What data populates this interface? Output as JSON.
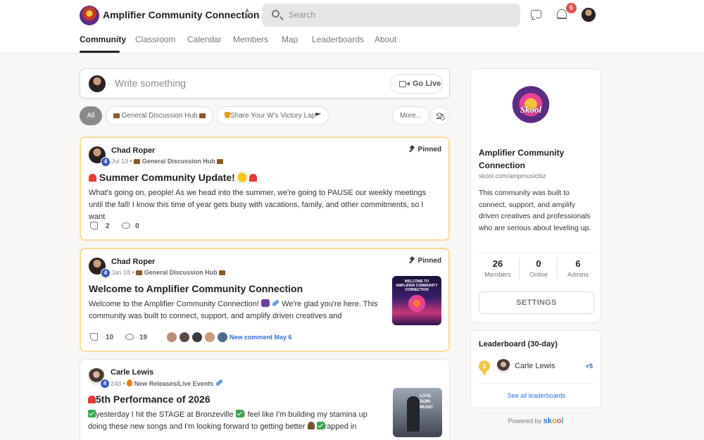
{
  "header": {
    "title": "Amplifier Community Connection",
    "search_placeholder": "Search",
    "notification_count": "6"
  },
  "tabs": [
    {
      "label": "Community"
    },
    {
      "label": "Classroom"
    },
    {
      "label": "Calendar"
    },
    {
      "label": "Members"
    },
    {
      "label": "Map"
    },
    {
      "label": "Leaderboards"
    },
    {
      "label": "About"
    }
  ],
  "composer": {
    "placeholder": "Write something",
    "go_live": "Go Live"
  },
  "filters": {
    "all": "All",
    "chip1": "General Discussion Hub",
    "chip2": "Share Your W's Victory Lap",
    "more": "More..."
  },
  "posts": [
    {
      "author": "Chad Roper",
      "level": "4",
      "date": "Jul 13",
      "category": "General Discussion Hub",
      "pinned": "Pinned",
      "title": "Summer Community Update!",
      "body": "What's going on, people! As we head into the summer, we're going to PAUSE our weekly meetings until the fall! I know this time of year gets busy with vacations, family, and other commitments, so I want",
      "likes": "2",
      "comments": "0"
    },
    {
      "author": "Chad Roper",
      "level": "4",
      "date": "Jan 18",
      "category": "General Discussion Hub",
      "pinned": "Pinned",
      "title": "Welcome to Amplifier Community Connection",
      "body_a": "Welcome to the Amplifier Community Connection!",
      "body_b": "We're glad you're here. This community was built to connect, support, and amplify driven creatives and",
      "likes": "10",
      "comments": "19",
      "new_comment": "New comment May 6",
      "thumb_text": "WELCOME TO AMPLIFIER COMMUNITY CONNECTION"
    },
    {
      "author": "Carle Lewis",
      "level": "4",
      "date": "24d",
      "category": "New Releases/Live Events",
      "title": "5th Performance of 2026",
      "body_a": "yesterday I hit the STAGE at Bronzeville",
      "body_b": "I feel like I'm building my stamina up doing these new songs and I'm looking forward to getting better",
      "body_c": "rapped in",
      "thumb_text": "LOVE DOIN MUSIC"
    }
  ],
  "sidebar": {
    "logo_word": "Skool",
    "name": "Amplifier Community Connection",
    "url": "skool.com/ampmusicbiz",
    "description": "This community was built to connect, support, and amplify driven creatives and professionals who are serious about leveling up.",
    "stats": [
      {
        "value": "26",
        "label": "Members"
      },
      {
        "value": "0",
        "label": "Online"
      },
      {
        "value": "6",
        "label": "Admins"
      }
    ],
    "settings": "SETTINGS"
  },
  "leaderboard": {
    "title": "Leaderboard (30-day)",
    "rank": "1",
    "name": "Carle Lewis",
    "points": "+5",
    "link": "See all leaderboards"
  },
  "footer": {
    "powered_by": "Powered by",
    "brand": "skool"
  },
  "colors": {
    "accent_blue": "#2f6fd6",
    "pinned_border": "#f7dc9c",
    "badge_red": "#e54f4f"
  }
}
